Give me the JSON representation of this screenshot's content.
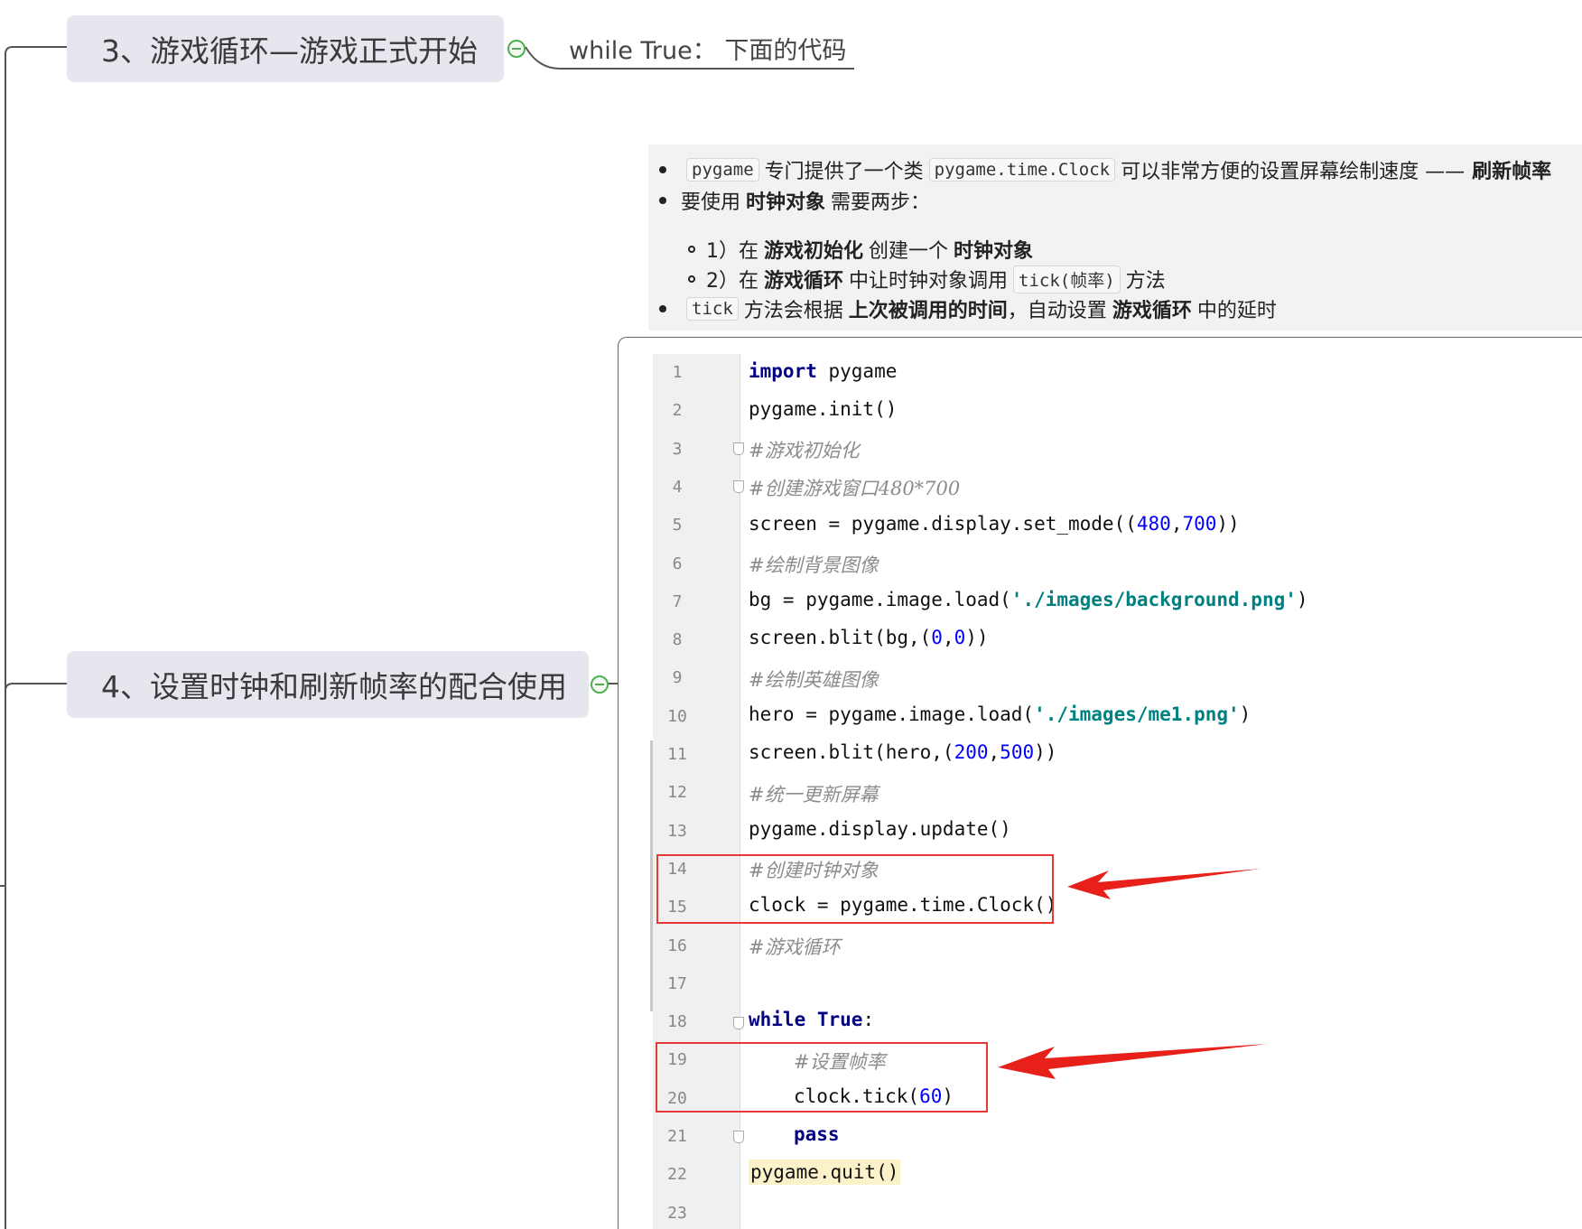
{
  "mindmap": {
    "topic3": {
      "label": "3、游戏循环—游戏正式开始",
      "subtopic": "while True： 下面的代码"
    },
    "topic4": {
      "label": "4、设置时钟和刷新帧率的配合使用"
    }
  },
  "notes": {
    "line1": {
      "code1": "pygame",
      "text1": "专门提供了一个类",
      "code2": "pygame.time.Clock",
      "text2": "可以非常方便的设置屏幕绘制速度 ——",
      "bold": "刷新帧率"
    },
    "line2": {
      "text1": "要使用",
      "bold": "时钟对象",
      "text2": "需要两步："
    },
    "step1": {
      "prefix": "1）在",
      "bold1": "游戏初始化",
      "mid": "创建一个",
      "bold2": "时钟对象"
    },
    "step2": {
      "prefix": "2）在",
      "bold1": "游戏循环",
      "mid": "中让时钟对象调用",
      "code": "tick(帧率)",
      "suffix": "方法"
    },
    "line3": {
      "code": "tick",
      "text1": "方法会根据",
      "bold1": "上次被调用的时间",
      "text2": "，自动设置",
      "bold2": "游戏循环",
      "text3": "中的延时"
    }
  },
  "code": {
    "line_numbers": [
      "1",
      "2",
      "3",
      "4",
      "5",
      "6",
      "7",
      "8",
      "9",
      "10",
      "11",
      "12",
      "13",
      "14",
      "15",
      "16",
      "17",
      "18",
      "19",
      "20",
      "21",
      "22",
      "23"
    ],
    "l1": {
      "kw": "import",
      "rest": " pygame"
    },
    "l2": "pygame.init()",
    "l3": "#游戏初始化",
    "l4": "#创建游戏窗口480*700",
    "l5": {
      "a": "screen = pygame.display.set_mode((",
      "n1": "480",
      "c": ",",
      "n2": "700",
      "b": "))"
    },
    "l6": "#绘制背景图像",
    "l7": {
      "a": "bg = pygame.image.load(",
      "s": "'./images/background.png'",
      "b": ")"
    },
    "l8": {
      "a": "screen.blit(bg,(",
      "n1": "0",
      "c": ",",
      "n2": "0",
      "b": "))"
    },
    "l9": "#绘制英雄图像",
    "l10": {
      "a": "hero = pygame.image.load(",
      "s": "'./images/me1.png'",
      "b": ")"
    },
    "l11": {
      "a": "screen.blit(hero,(",
      "n1": "200",
      "c": ",",
      "n2": "500",
      "b": "))"
    },
    "l12": "#统一更新屏幕",
    "l13": "pygame.display.update()",
    "l14": "#创建时钟对象",
    "l15": "clock = pygame.time.Clock()",
    "l16": "#游戏循环",
    "l18": {
      "kw1": "while",
      "sp": " ",
      "kw2": "True",
      "b": ":"
    },
    "l19": "#设置帧率",
    "l20": {
      "a": "clock.tick(",
      "n": "60",
      "b": ")"
    },
    "l21": "pass",
    "l22": "pygame.quit()"
  },
  "colors": {
    "highlight_box": "#e53935",
    "arrow": "#e8201a",
    "topic_bg": "#e6e7ee",
    "collapse_green": "#4caf50"
  }
}
